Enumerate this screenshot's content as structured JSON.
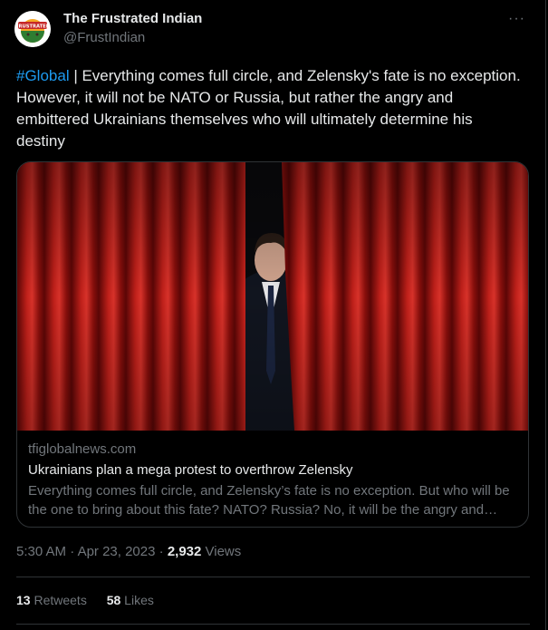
{
  "author": {
    "name": "The Frustrated Indian",
    "handle": "@FrustIndian",
    "avatar_text": "FRUSTRATED"
  },
  "more_label": "···",
  "tweet": {
    "hashtag": "#Global",
    "body": " | Everything comes full circle, and Zelensky's fate is no exception. However, it will not be NATO or Russia, but rather the angry and embittered Ukrainians themselves who will ultimately determine his destiny"
  },
  "card": {
    "domain": "tfiglobalnews.com",
    "title": "Ukrainians plan a mega protest to overthrow Zelensky",
    "description": "Everything comes full circle, and Zelensky’s fate is no exception. But who will be the one to bring about this fate? NATO? Russia? No, it will be the angry and embittered Ukrainians themselves"
  },
  "meta": {
    "time": "5:30 AM",
    "separator": " · ",
    "date": "Apr 23, 2023",
    "views_count": "2,932",
    "views_label": " Views"
  },
  "stats": {
    "retweets_count": "13",
    "retweets_label": " Retweets",
    "likes_count": "58",
    "likes_label": " Likes"
  },
  "colors": {
    "background": "#000000",
    "link": "#1d9bf0",
    "text": "#e7e9ea",
    "secondary": "#71767b",
    "border": "#2f3336",
    "curtain": "#b01a16"
  }
}
